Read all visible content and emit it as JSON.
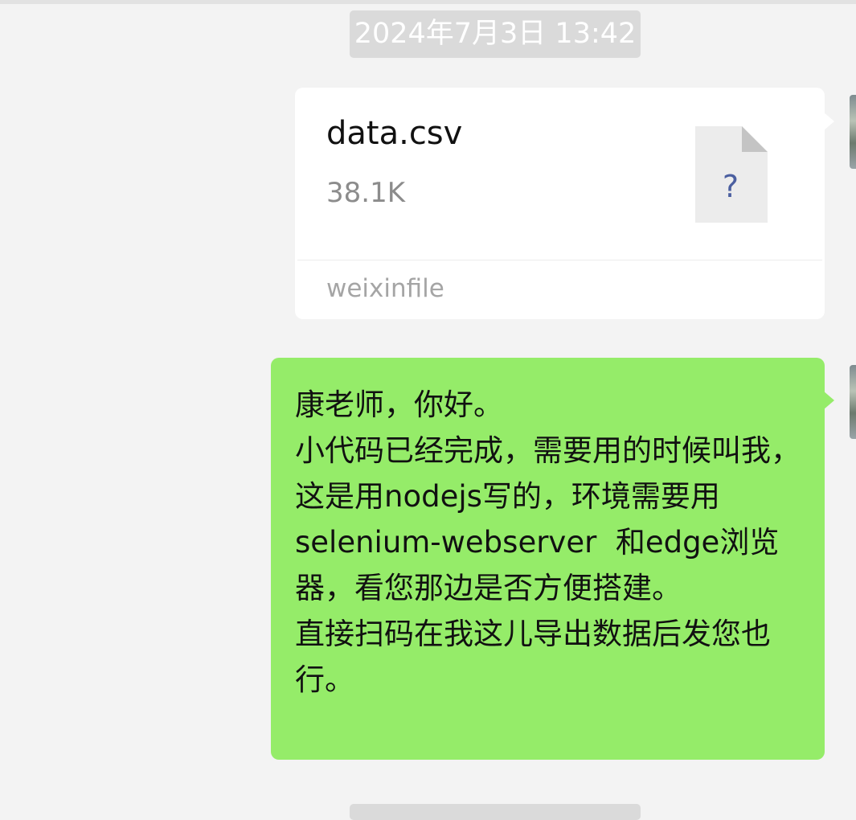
{
  "chat": {
    "timestamp": "2024年7月3日 13:42",
    "file_message": {
      "file_name": "data.csv",
      "file_size": "38.1K",
      "source": "weixinfile",
      "icon": "file-unknown-icon",
      "icon_glyph": "?"
    },
    "text_message": {
      "text": "康老师，你好。\n小代码已经完成，需要用的时候叫我，这是用nodejs写的，环境需要用selenium-webserver  和edge浏览器，看您那边是否方便搭建。\n直接扫码在我这儿导出数据后发您也行。"
    }
  },
  "colors": {
    "background": "#f3f3f3",
    "outgoing_bubble": "#95ec69",
    "file_card": "#ffffff",
    "timestamp_bg": "#dadada"
  }
}
